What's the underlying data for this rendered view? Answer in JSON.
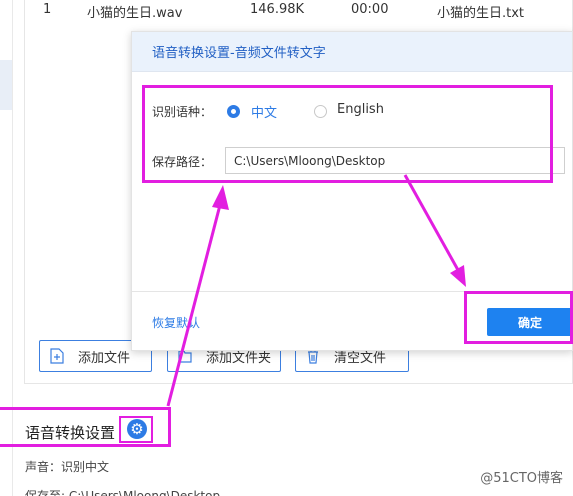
{
  "file_row": {
    "index": "1",
    "name": "小猫的生日.wav",
    "size": "146.98K",
    "duration": "00:00",
    "output": "小猫的生日.txt"
  },
  "buttons": {
    "add_file": "添加文件",
    "add_folder": "添加文件夹",
    "clear": "清空文件"
  },
  "settings": {
    "title": "语音转换设置",
    "voice": "声音：识别中文",
    "save_to": "保存至: C:\\Users\\Mloong\\Desktop"
  },
  "dialog": {
    "title": "语音转换设置-音频文件转文字",
    "lang_label": "识别语种：",
    "lang_options": [
      "中文",
      "English"
    ],
    "selected_lang": "中文",
    "path_label": "保存路径：",
    "path_value": "C:\\Users\\Mloong\\Desktop",
    "reset": "恢复默认",
    "ok": "确定"
  },
  "watermark": "@51CTO博客",
  "colors": {
    "accent": "#2d7be5",
    "highlight": "#e21ee0",
    "primary_button": "#1e82f0"
  },
  "icons": [
    "add-file-icon",
    "add-folder-icon",
    "trash-icon",
    "gear-icon"
  ]
}
